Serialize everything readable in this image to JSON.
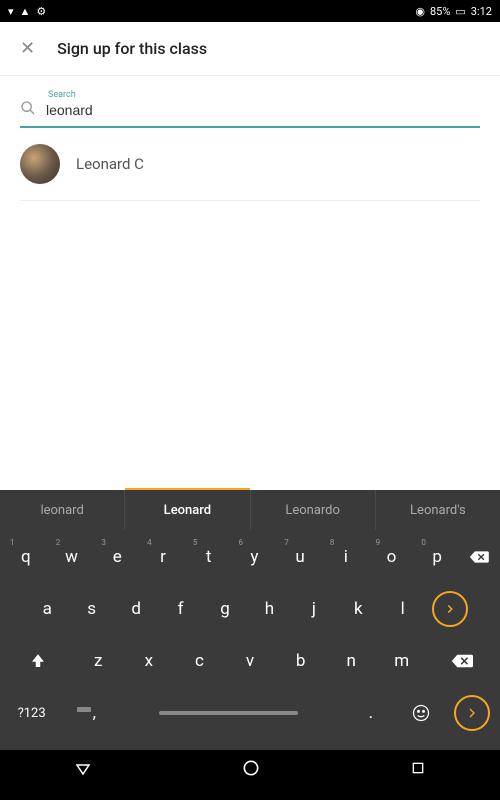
{
  "statusBar": {
    "battery": "85%",
    "time": "3:12"
  },
  "header": {
    "title": "Sign up for this class"
  },
  "search": {
    "label": "Search",
    "value": "leonard"
  },
  "results": [
    {
      "name": "Leonard C"
    }
  ],
  "suggestions": [
    "leonard",
    "Leonard",
    "Leonardo",
    "Leonard's"
  ],
  "keyboard": {
    "row1": [
      {
        "k": "q",
        "n": "1"
      },
      {
        "k": "w",
        "n": "2"
      },
      {
        "k": "e",
        "n": "3"
      },
      {
        "k": "r",
        "n": "4"
      },
      {
        "k": "t",
        "n": "5"
      },
      {
        "k": "y",
        "n": "6"
      },
      {
        "k": "u",
        "n": "7"
      },
      {
        "k": "i",
        "n": "8"
      },
      {
        "k": "o",
        "n": "9"
      },
      {
        "k": "p",
        "n": "0"
      }
    ],
    "row2": [
      "a",
      "s",
      "d",
      "f",
      "g",
      "h",
      "j",
      "k",
      "l"
    ],
    "row3": [
      "z",
      "x",
      "c",
      "v",
      "b",
      "n",
      "m"
    ],
    "symKey": "?123",
    "period": "."
  }
}
